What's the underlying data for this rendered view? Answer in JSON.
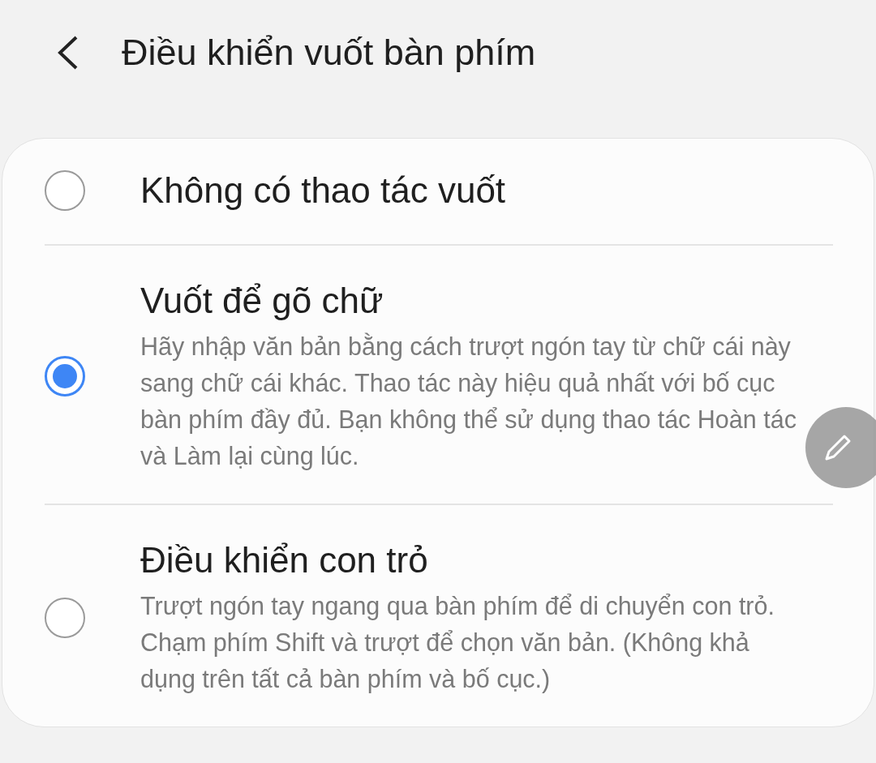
{
  "header": {
    "title": "Điều khiển vuốt bàn phím"
  },
  "options": [
    {
      "title": "Không có thao tác vuốt",
      "selected": false
    },
    {
      "title": "Vuốt để gõ chữ",
      "description": "Hãy nhập văn bản bằng cách trượt ngón tay từ chữ cái này sang chữ cái khác. Thao tác này hiệu quả nhất với bố cục bàn phím đầy đủ. Bạn không thể sử dụng thao tác Hoàn tác và Làm lại cùng lúc.",
      "selected": true
    },
    {
      "title": "Điều khiển con trỏ",
      "description": "Trượt ngón tay ngang qua bàn phím để di chuyển con trỏ. Chạm phím Shift và trượt để chọn văn bản. (Không khả dụng trên tất cả bàn phím và bố cục.)",
      "selected": false
    }
  ]
}
